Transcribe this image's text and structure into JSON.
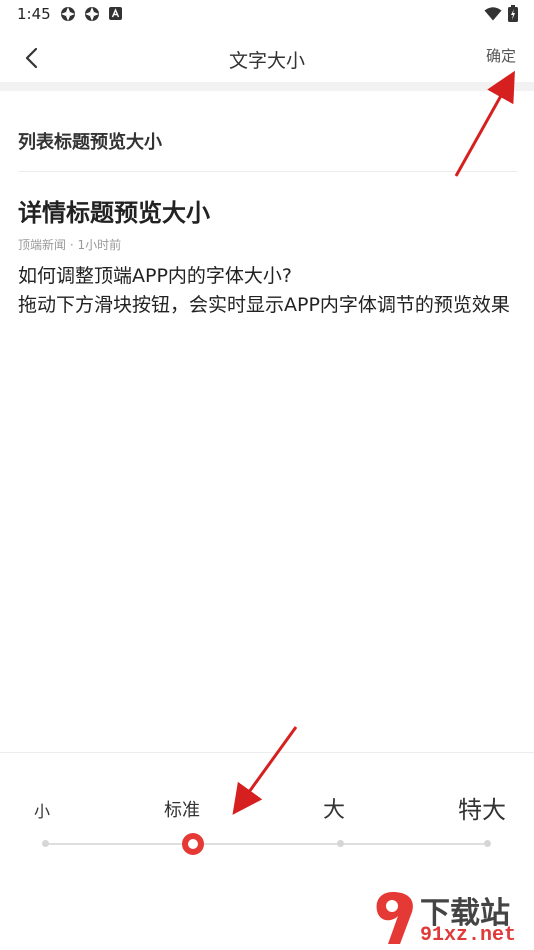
{
  "status_bar": {
    "time": "1:45"
  },
  "nav": {
    "title": "文字大小",
    "confirm": "确定"
  },
  "preview": {
    "list_title": "列表标题预览大小",
    "detail_title": "详情标题预览大小",
    "meta": "顶端新闻 · 1小时前",
    "body_line1": "如何调整顶端APP内的字体大小?",
    "body_line2": "拖动下方滑块按钮，会实时显示APP内字体调节的预览效果"
  },
  "font_size_slider": {
    "options": [
      "小",
      "标准",
      "大",
      "特大"
    ],
    "selected_index": 1,
    "accent_color": "#e53935"
  },
  "watermark": {
    "top": "下载站",
    "bottom": "91xz.net"
  },
  "colors": {
    "accent": "#e53935",
    "arrow": "#d62020"
  }
}
